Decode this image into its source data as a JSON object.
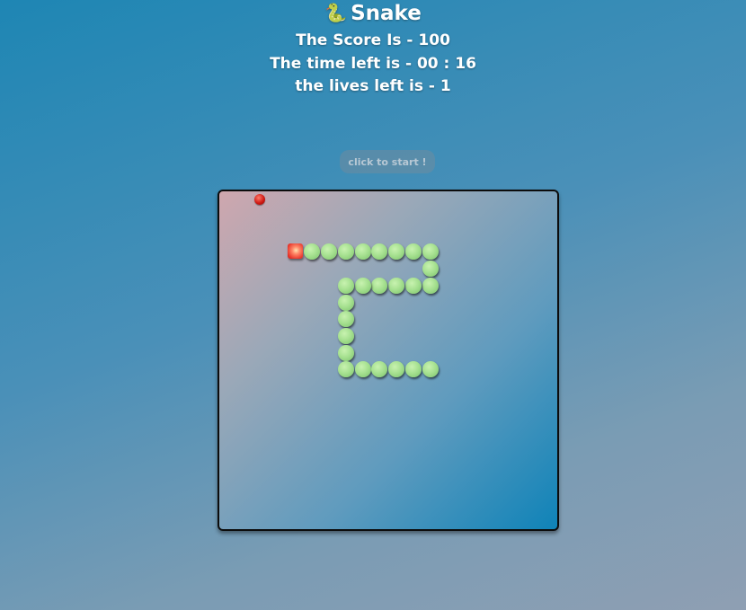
{
  "game": {
    "title": "Snake",
    "title_icon": "snake-emoji",
    "score_text": "The Score Is - 100",
    "time_text": "The time left is - 00 : 16",
    "lives_text": "the lives left is - 1",
    "start_label": "click to start !"
  },
  "colors": {
    "snake_body": "#a7e191",
    "snake_head": "#e8352b",
    "apple": "#d01a14",
    "board_border": "#0c0c0c"
  }
}
